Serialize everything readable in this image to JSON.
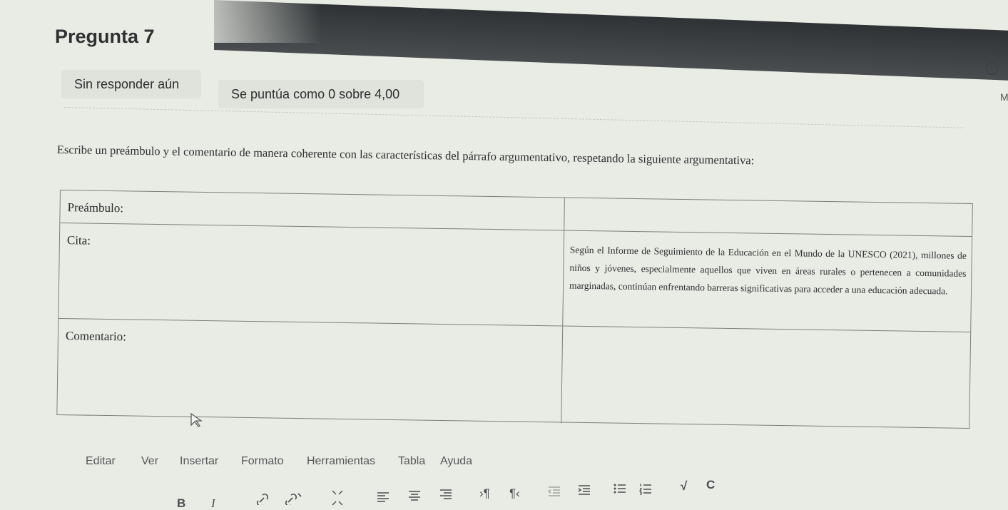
{
  "question": {
    "title": "Pregunta 7",
    "state_label": "Sin responder aún",
    "grade_label": "Se puntúa como 0 sobre 4,00",
    "side_letter": "M"
  },
  "prompt_text": "Escribe un preámbulo y el comentario de manera coherente con las características del párrafo argumentativo, respetando la siguiente argumentativa:",
  "table": {
    "rows": [
      {
        "label": "Preámbulo:",
        "content": ""
      },
      {
        "label": "Cita:",
        "content": "Según el Informe de Seguimiento de la Educación en el Mundo de la UNESCO (2021), millones de niños y jóvenes, especialmente aquellos que viven en áreas rurales o pertenecen a comunidades marginadas, continúan enfrentando barreras significativas para acceder a una educación adecuada."
      },
      {
        "label": "Comentario:",
        "content": ""
      }
    ]
  },
  "editor": {
    "menu": [
      "Editar",
      "Ver",
      "Insertar",
      "Formato",
      "Herramientas",
      "Tabla",
      "Ayuda"
    ],
    "toolbar_icons": [
      "bold-icon",
      "italic-icon",
      "link-icon",
      "unlink-icon",
      "fullscreen-icon",
      "align-left-icon",
      "align-center-icon",
      "align-right-icon",
      "ltr-icon",
      "rtl-icon",
      "outdent-icon",
      "indent-icon",
      "bullet-list-icon",
      "numbered-list-icon",
      "math-icon",
      "refresh-icon"
    ]
  }
}
